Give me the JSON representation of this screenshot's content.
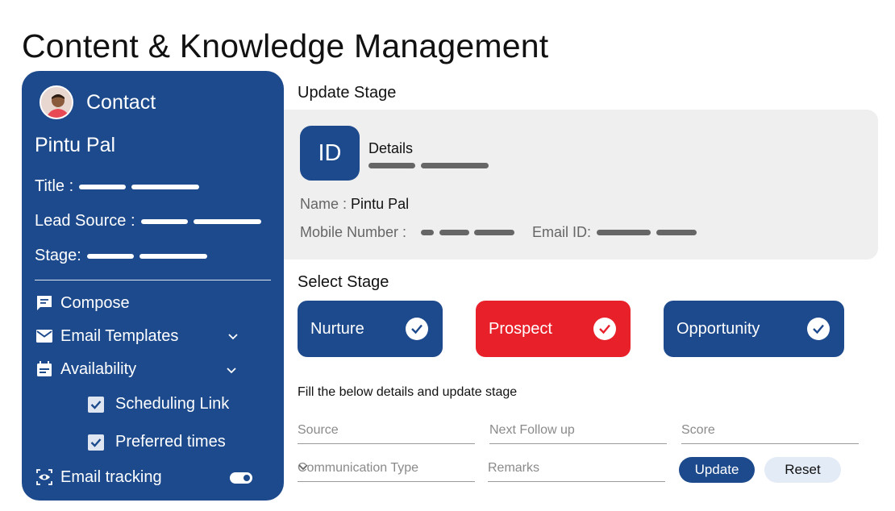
{
  "page": {
    "title": "Content & Knowledge Management"
  },
  "sidebar": {
    "header": "Contact",
    "name": "Pintu Pal",
    "fields": {
      "title": "Title :",
      "lead_source": "Lead Source :",
      "stage": "Stage:"
    },
    "menu": {
      "compose": "Compose",
      "email_templates": "Email Templates",
      "availability": "Availability",
      "scheduling_link": "Scheduling Link",
      "preferred_times": "Preferred times",
      "email_tracking": "Email tracking"
    },
    "email_tracking_enabled": true
  },
  "update_stage": {
    "title": "Update Stage",
    "badge": "ID",
    "details_label": "Details",
    "name_label": "Name :",
    "name_value": "Pintu Pal",
    "mobile_label": "Mobile Number :",
    "email_label": "Email ID:"
  },
  "select_stage": {
    "title": "Select Stage",
    "options": [
      {
        "label": "Nurture",
        "selected": false
      },
      {
        "label": "Prospect",
        "selected": true
      },
      {
        "label": "Opportunity",
        "selected": false
      }
    ]
  },
  "form": {
    "hint": "Fill the below details and update stage",
    "source": "Source",
    "next_follow_up": "Next Follow up",
    "score": "Score",
    "communication_type": "Communication Type",
    "remarks": "Remarks",
    "update_label": "Update",
    "reset_label": "Reset"
  },
  "colors": {
    "primary": "#1d4a8c",
    "selected": "#e8202a",
    "card_bg": "#efefef"
  }
}
